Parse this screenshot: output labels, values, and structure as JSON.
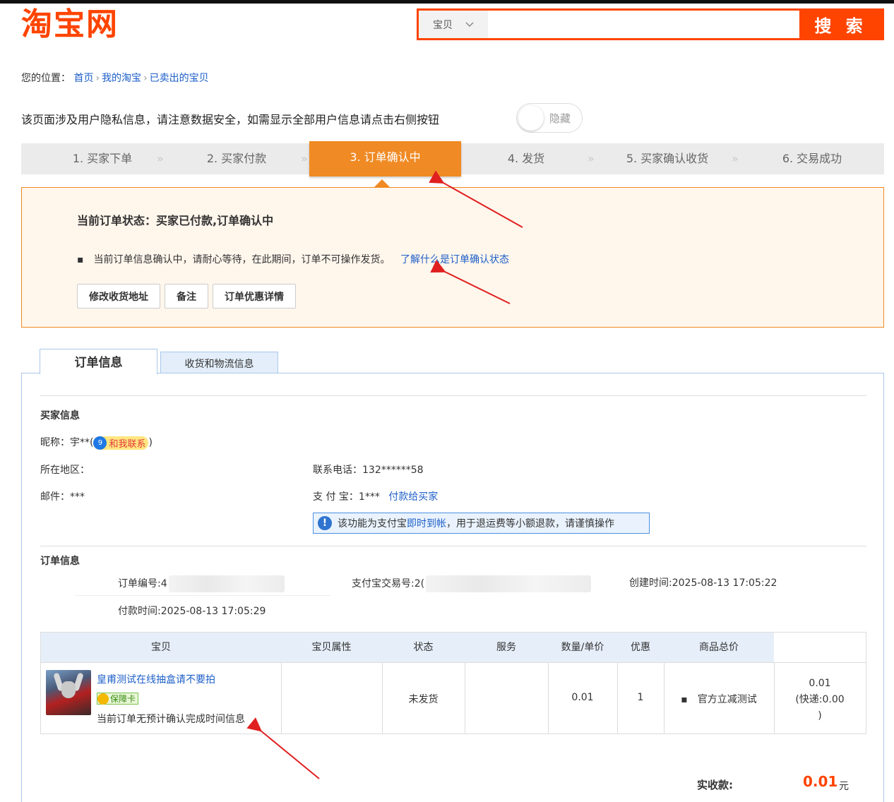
{
  "logo": "淘宝网",
  "search": {
    "category": "宝贝",
    "input_value": "",
    "button_label": "搜 索"
  },
  "breadcrumb": {
    "prefix": "您的位置：",
    "items": [
      "首页",
      "我的淘宝",
      "已卖出的宝贝"
    ],
    "separator": "›"
  },
  "privacy": {
    "text": "该页面涉及用户隐私信息，请注意数据安全，如需显示全部用户信息请点击右侧按钮",
    "toggle_label": "隐藏"
  },
  "steps": [
    {
      "label": "1. 买家下单"
    },
    {
      "label": "2. 买家付款"
    },
    {
      "label": "3. 订单确认中"
    },
    {
      "label": "4. 发货"
    },
    {
      "label": "5. 买家确认收货"
    },
    {
      "label": "6. 交易成功"
    }
  ],
  "step_arrow": "»",
  "status": {
    "title": "当前订单状态：买家已付款,订单确认中",
    "bullet": "▪",
    "desc": "当前订单信息确认中，请耐心等待，在此期间，订单不可操作发货。",
    "link": "了解什么是订单确认状态",
    "buttons": [
      "修改收货地址",
      "备注",
      "订单优惠详情"
    ]
  },
  "tabs": {
    "active": "订单信息",
    "inactive": "收货和物流信息"
  },
  "buyer": {
    "section_title": "买家信息",
    "nickname_label": "昵称：",
    "nickname_value": "宇**(",
    "contact_bubble": "9",
    "contact_label": "和我联系",
    "nickname_close": ")",
    "region_label": "所在地区：",
    "phone_label": "联系电话：",
    "phone_value": "132******58",
    "email_label": "邮件：",
    "email_value": "***",
    "alipay_label": "支 付 宝：",
    "alipay_value": "1***",
    "alipay_link": "付款给买家",
    "notice_prefix": "该功能为支付宝",
    "notice_link": "即时到帐",
    "notice_suffix": "，用于退运费等小额退款，请谨慎操作"
  },
  "order": {
    "section_title": "订单信息",
    "order_no_label": "订单编号:4",
    "alipay_trade_label": "支付宝交易号:2(",
    "created_label": "创建时间:",
    "created_value": "2025-08-13 17:05:22",
    "paid_label": "付款时间:",
    "paid_value": "2025-08-13 17:05:29"
  },
  "table": {
    "headers": [
      "宝贝",
      "宝贝属性",
      "状态",
      "服务",
      "数量/单价",
      "优惠",
      "商品总价"
    ],
    "row": {
      "title": "皇甫测试在线抽盒请不要拍",
      "badge": "保障卡",
      "note": "当前订单无预计确认完成时间信息",
      "attributes": "",
      "status": "未发货",
      "service": "",
      "unit_price": "0.01",
      "quantity": "1",
      "discount_bullet": "▪",
      "discount": "官方立减测试",
      "total_line1": "0.01",
      "total_line2": "(快递:0.00",
      "total_line3": ")"
    }
  },
  "actual": {
    "label": "实收款:",
    "amount": "0.01",
    "unit": "元"
  },
  "colors": {
    "brand": "#ff4400",
    "step_active": "#f08a24",
    "link": "#1e5fc8",
    "arrow": "#e02020"
  },
  "icons": [
    "chevron-down-icon",
    "info-icon",
    "contact-icon",
    "guarantee-icon"
  ]
}
